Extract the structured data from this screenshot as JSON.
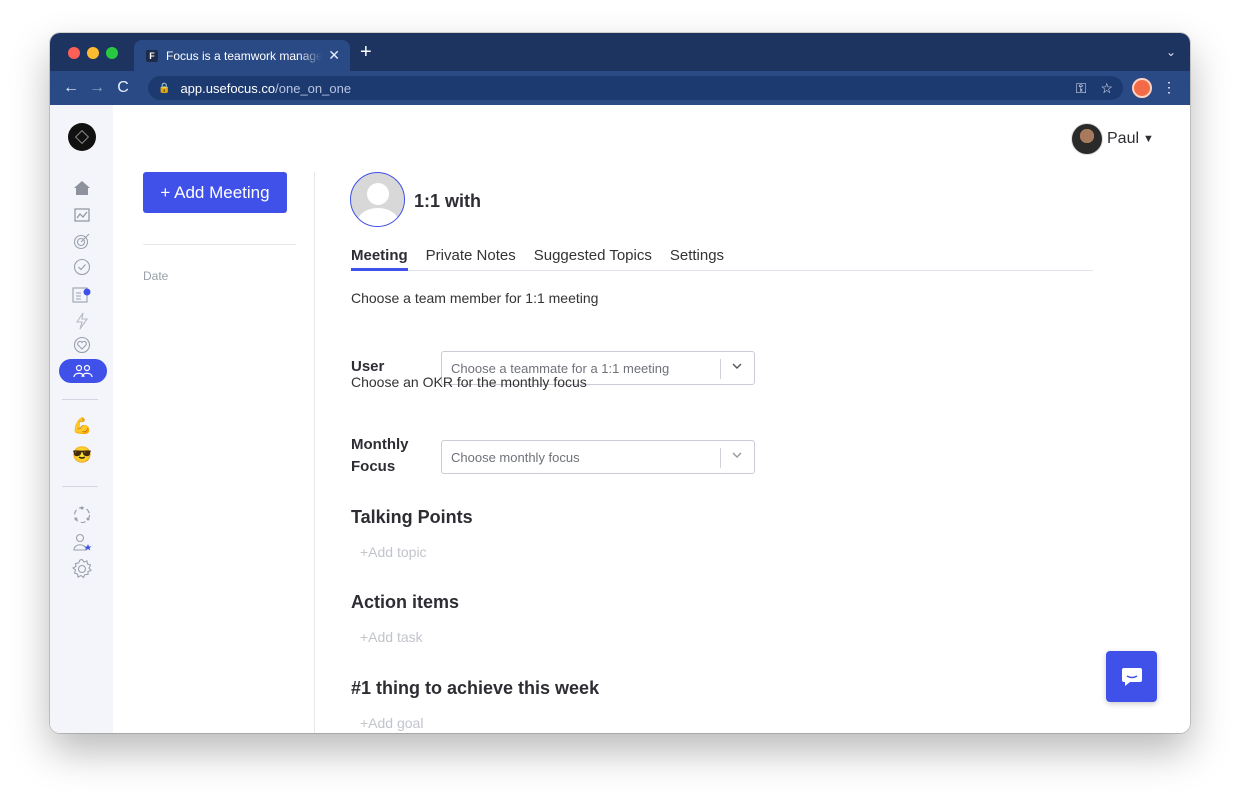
{
  "browser": {
    "tab_title": "Focus is a teamwork management",
    "tab_favicon": "F",
    "new_tab": "+",
    "url_host": "app.usefocus.co",
    "url_path": "/one_on_one"
  },
  "header": {
    "user_name": "Paul"
  },
  "left_panel": {
    "add_meeting_label": "+ Add Meeting",
    "date_label": "Date"
  },
  "main": {
    "title": "1:1 with",
    "tabs": [
      {
        "label": "Meeting",
        "active": true
      },
      {
        "label": "Private Notes",
        "active": false
      },
      {
        "label": "Suggested Topics",
        "active": false
      },
      {
        "label": "Settings",
        "active": false
      }
    ],
    "member_prompt": "Choose a team member for 1:1 meeting",
    "user_label": "User",
    "user_placeholder": "Choose a teammate for a 1:1 meeting",
    "okr_prompt": "Choose an OKR for the monthly focus",
    "monthly_label_line1": "Monthly",
    "monthly_label_line2": "Focus",
    "monthly_placeholder": "Choose monthly focus",
    "talking_points_title": "Talking Points",
    "add_topic": "+Add topic",
    "action_items_title": "Action items",
    "add_task": "+Add task",
    "goal_title": "#1 thing to achieve this week",
    "add_goal": "+Add goal"
  },
  "colors": {
    "accent": "#3f51e8",
    "browser_dark": "#1d3461",
    "browser_toolbar": "#2a4a85"
  },
  "icons": [
    "home-icon",
    "chart-icon",
    "target-icon",
    "check-circle-icon",
    "feed-icon",
    "lightning-icon",
    "heart-icon",
    "team-icon",
    "flexed-bicep-icon",
    "sunglasses-icon",
    "org-icon",
    "person-star-icon",
    "gear-icon",
    "chat-icon"
  ]
}
